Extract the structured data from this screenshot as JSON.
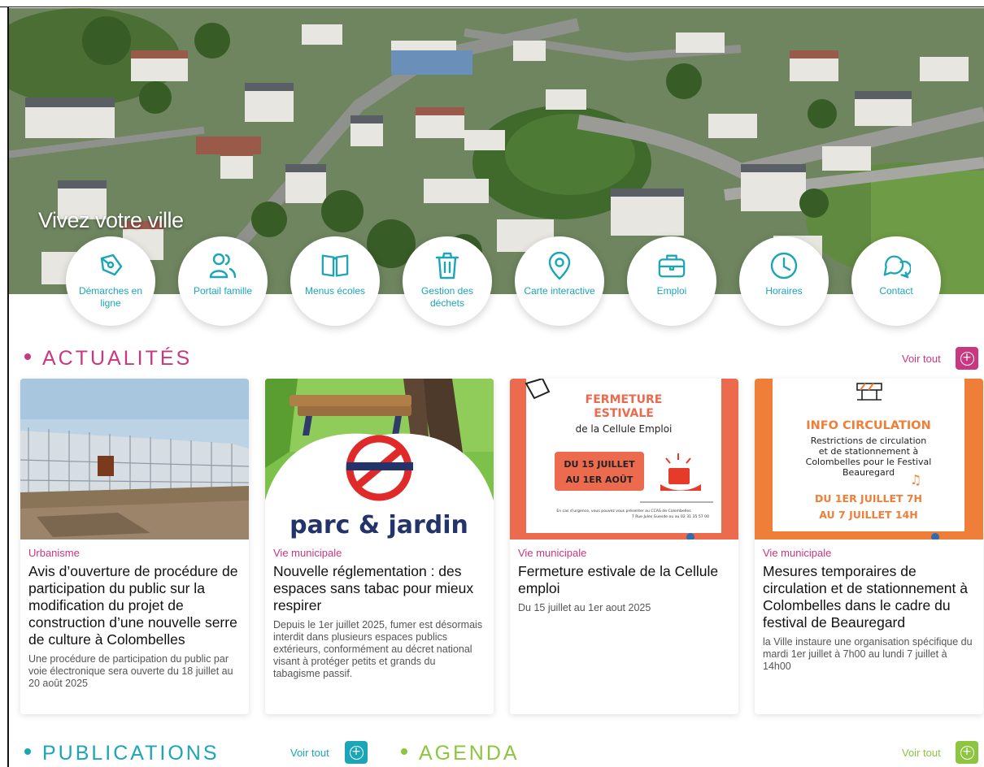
{
  "hero": {
    "title": "Vivez votre ville"
  },
  "quick_links": [
    {
      "label": "Démarches en ligne",
      "icon": "pen-nib-icon"
    },
    {
      "label": "Portail famille",
      "icon": "users-icon"
    },
    {
      "label": "Menus écoles",
      "icon": "book-icon"
    },
    {
      "label": "Gestion des déchets",
      "icon": "trash-icon"
    },
    {
      "label": "Carte interactive",
      "icon": "map-pin-icon"
    },
    {
      "label": "Emploi",
      "icon": "briefcase-icon"
    },
    {
      "label": "Horaires",
      "icon": "clock-icon"
    },
    {
      "label": "Contact",
      "icon": "chat-bubbles-icon"
    }
  ],
  "news": {
    "title": "ACTUALITÉS",
    "see_all": "Voir tout",
    "color": "#c8377f",
    "items": [
      {
        "category": "Urbanisme",
        "title": "Avis d’ouverture de procédure de participation du public sur la modification du projet de construction d’une nouvelle serre de culture à Colombelles",
        "description": "Une procédure de participation du public par voie électronique sera ouverte du 18 juillet au 20 août 2025"
      },
      {
        "category": "Vie municipale",
        "title": "Nouvelle réglementation : des espaces sans tabac pour mieux respirer",
        "description": "Depuis le 1er juillet 2025, fumer est désormais interdit dans plusieurs espaces publics extérieurs, conformément au décret national visant à protéger petits et grands du tabagisme passif.",
        "image_text": "parc & jardin"
      },
      {
        "category": "Vie municipale",
        "title": "Fermeture estivale de la Cellule emploi",
        "description": "Du 15 juillet au 1er aout 2025",
        "image_text": {
          "line1": "FERMETURE",
          "line2": "ESTIVALE",
          "line3": "de la Cellule Emploi",
          "dates1": "DU 15 JUILLET",
          "dates2": "AU 1ER AOÛT",
          "small1": "En cas d’urgence, vous pouvez vous présenter au CCAS de Colombelles",
          "small2": "7 Rue Jules Guesde ou au 02 31 35 57 00"
        }
      },
      {
        "category": "Vie municipale",
        "title": "Mesures temporaires de circulation et de stationnement à Colombelles dans le cadre du festival de Beauregard",
        "description": "la Ville instaure une organisation spécifique du mardi 1er juillet à 7h00 au lundi 7 juillet à 14h00",
        "image_text": {
          "heading": "INFO CIRCULATION",
          "body1": "Restrictions de circulation",
          "body2": "et de stationnement à",
          "body3": "Colombelles pour le Festival",
          "body4": "Beauregard",
          "dates1": "DU 1ER JUILLET 7H",
          "dates2": "AU 7 JUILLET 14H"
        }
      }
    ]
  },
  "publications": {
    "title": "PUBLICATIONS",
    "see_all": "Voir tout",
    "color": "#1aa6b7"
  },
  "agenda": {
    "title": "AGENDA",
    "see_all": "Voir tout",
    "color": "#8cc63f"
  }
}
